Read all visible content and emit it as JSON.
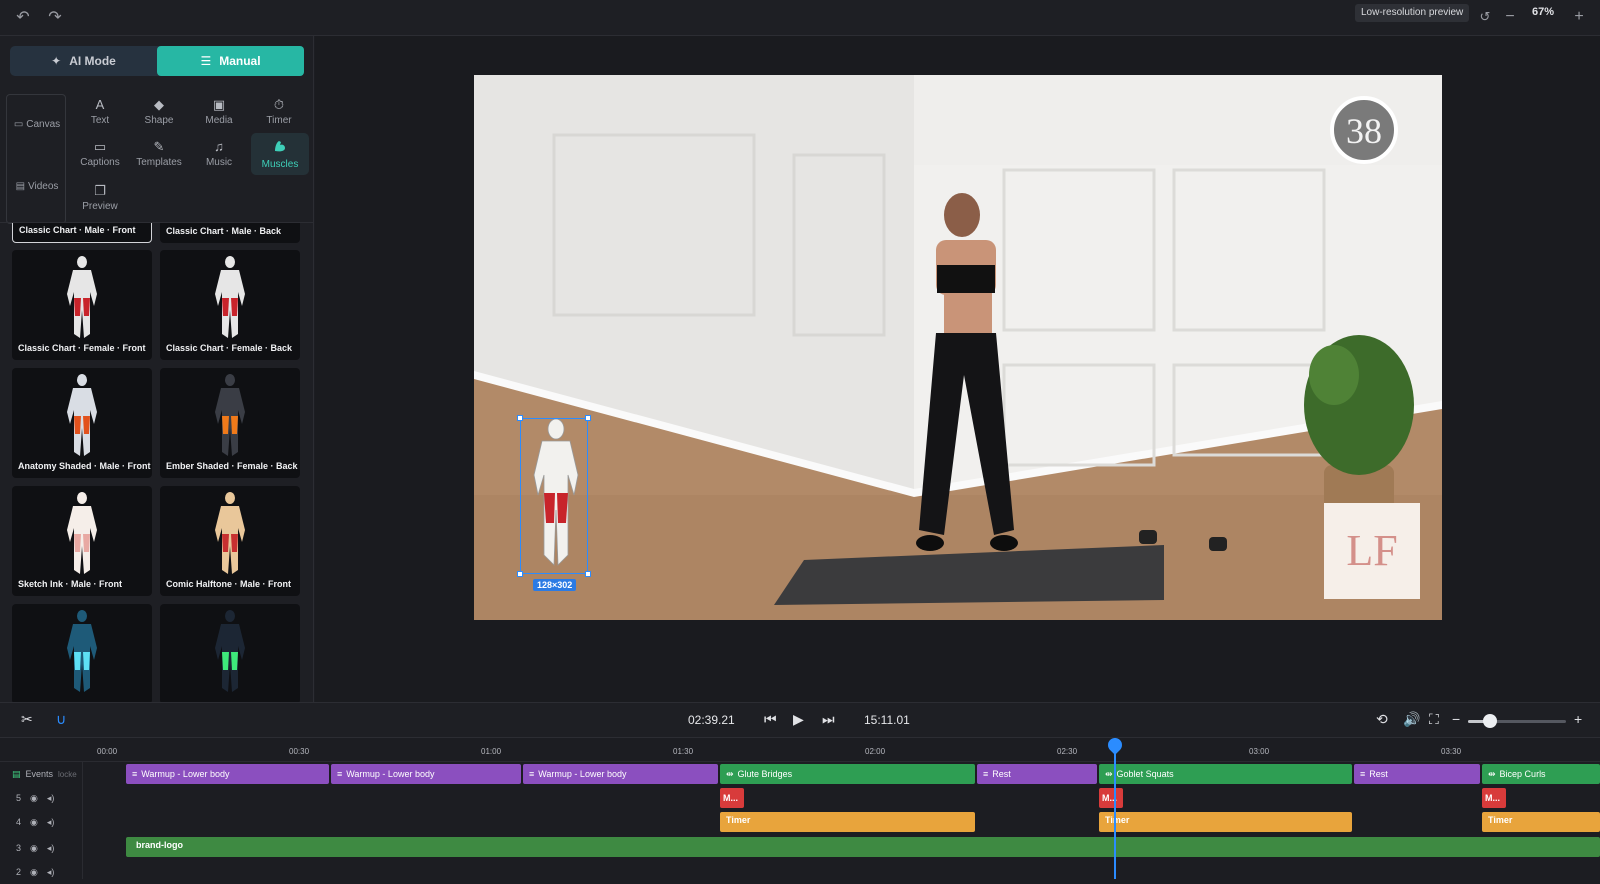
{
  "toolbar": {
    "undo_icon": "undo-icon",
    "redo_icon": "redo-icon",
    "lowres_label": "Low-resolution preview",
    "zoom_value": "67%",
    "reset_icon": "reset-zoom-icon",
    "zoom_out": "−",
    "zoom_in": "+"
  },
  "mode": {
    "ai_label": "AI Mode",
    "manual_label": "Manual",
    "active": "Manual"
  },
  "side_tabs": [
    {
      "label": "Canvas",
      "icon": "monitor-icon"
    },
    {
      "label": "Videos",
      "icon": "film-icon"
    }
  ],
  "tools": [
    {
      "label": "Text",
      "glyph": "A"
    },
    {
      "label": "Shape",
      "glyph": "◆"
    },
    {
      "label": "Media",
      "glyph": "▣"
    },
    {
      "label": "Timer",
      "glyph": "⏱"
    },
    {
      "label": "Captions",
      "glyph": "▭"
    },
    {
      "label": "Templates",
      "glyph": "✎"
    },
    {
      "label": "Music",
      "glyph": "♫"
    },
    {
      "label": "Muscles",
      "glyph": "💪"
    },
    {
      "label": "Preview",
      "glyph": "❐"
    }
  ],
  "active_tool": "Muscles",
  "muscle_charts": [
    {
      "label": "Classic Chart · Male · Front",
      "selected": true
    },
    {
      "label": "Classic Chart · Male · Back"
    },
    {
      "label": "Classic Chart · Female · Front",
      "body": "#e6e6e6",
      "muscle": "#c8242b"
    },
    {
      "label": "Classic Chart · Female · Back",
      "body": "#e6e6e6",
      "muscle": "#c8242b"
    },
    {
      "label": "Anatomy Shaded · Male · Front",
      "body": "#d9dde4",
      "muscle": "#e2521d"
    },
    {
      "label": "Ember Shaded · Female · Back",
      "body": "#3a3d45",
      "muscle": "#f07a1a"
    },
    {
      "label": "Sketch Ink · Male · Front",
      "body": "#f5eee9",
      "muscle": "#e8a9a3"
    },
    {
      "label": "Comic Halftone · Male · Front",
      "body": "#e9c79a",
      "muscle": "#c83030"
    },
    {
      "label": "",
      "body": "#1e5a78",
      "muscle": "#5ee0f5"
    },
    {
      "label": "",
      "body": "#1c2634",
      "muscle": "#3ee87a"
    }
  ],
  "canvas": {
    "timer_badge": "38",
    "selection_size": "128×302",
    "logo_text": "LF"
  },
  "transport": {
    "current_time": "02:39.21",
    "total_time": "15:11.01",
    "zoom_level": 0.22
  },
  "timeline": {
    "ruler": [
      "00:00",
      "00:30",
      "01:00",
      "01:30",
      "02:00",
      "02:30",
      "03:00",
      "03:30"
    ],
    "tracks": [
      {
        "name": "Events",
        "note": "locke"
      },
      {
        "name": "5"
      },
      {
        "name": "4"
      },
      {
        "name": "3"
      },
      {
        "name": "2"
      }
    ],
    "event_clips": [
      {
        "label": "Warmup - Lower body",
        "kind": "purple"
      },
      {
        "label": "Warmup - Lower body",
        "kind": "purple"
      },
      {
        "label": "Warmup - Lower body",
        "kind": "purple"
      },
      {
        "label": "Glute Bridges",
        "kind": "green"
      },
      {
        "label": "Rest",
        "kind": "purple"
      },
      {
        "label": "Goblet Squats",
        "kind": "green"
      },
      {
        "label": "Rest",
        "kind": "purple"
      },
      {
        "label": "Bicep Curls",
        "kind": "green"
      }
    ],
    "muscle_clips": [
      "M...",
      "M...",
      "M..."
    ],
    "timer_clips": [
      "Timer",
      "Timer",
      "Timer"
    ],
    "logo_clip": "brand-logo"
  }
}
